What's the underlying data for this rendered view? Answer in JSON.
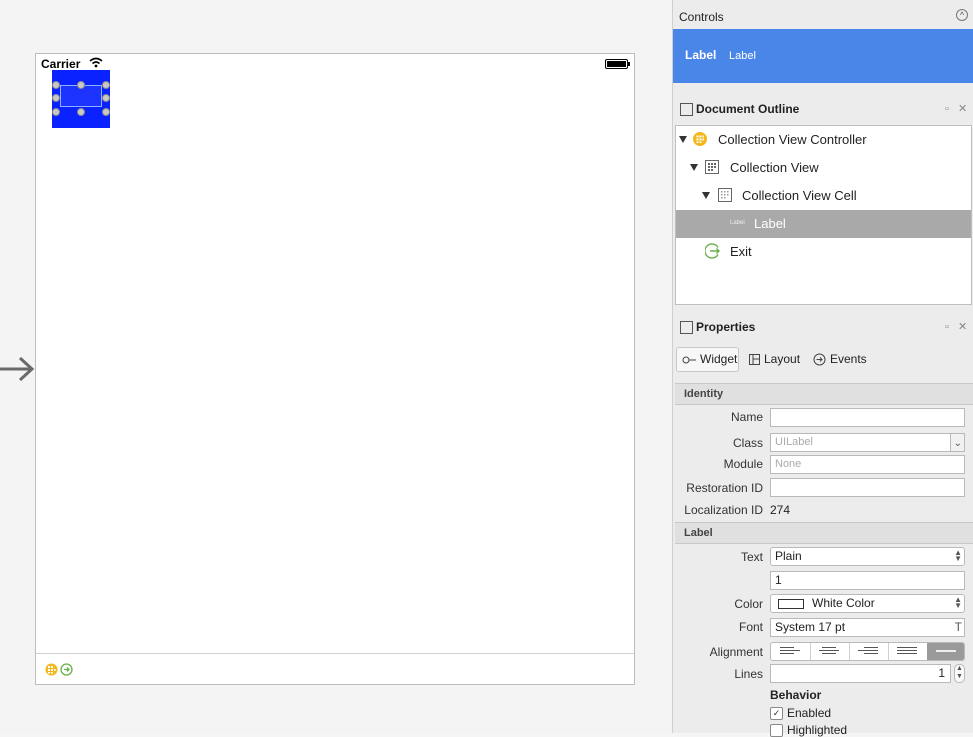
{
  "canvas": {
    "status_bar": {
      "carrier": "Carrier"
    }
  },
  "controls": {
    "title": "Controls",
    "items": [
      "Label",
      "Label"
    ]
  },
  "outline": {
    "title": "Document Outline",
    "rows": [
      {
        "label": "Collection View Controller",
        "icon": "view-controller-icon"
      },
      {
        "label": "Collection View",
        "icon": "collection-view-icon"
      },
      {
        "label": "Collection View Cell",
        "icon": "collection-view-cell-icon"
      },
      {
        "label": "Label",
        "icon": "label-icon",
        "selected": true
      },
      {
        "label": "Exit",
        "icon": "exit-icon"
      }
    ],
    "label_icon_text": "Label"
  },
  "properties": {
    "title": "Properties",
    "tabs": [
      "Widget",
      "Layout",
      "Events"
    ],
    "identity": {
      "header": "Identity",
      "name_label": "Name",
      "name_value": "",
      "class_label": "Class",
      "class_placeholder": "UILabel",
      "module_label": "Module",
      "module_placeholder": "None",
      "restoration_label": "Restoration ID",
      "restoration_value": "",
      "localization_label": "Localization ID",
      "localization_value": "274"
    },
    "label": {
      "header": "Label",
      "text_label": "Text",
      "text_value": "Plain",
      "text_content": "1",
      "color_label": "Color",
      "color_value": "White Color",
      "font_label": "Font",
      "font_value": "System 17 pt",
      "alignment_label": "Alignment",
      "lines_label": "Lines",
      "lines_value": "1",
      "behavior_header": "Behavior",
      "enabled_label": "Enabled",
      "enabled": true,
      "highlighted_label": "Highlighted",
      "highlighted": false
    }
  },
  "colors": {
    "accent": "#4a86e8",
    "cell_fill": "#0a22ff",
    "selection": "#a9a9a9"
  }
}
